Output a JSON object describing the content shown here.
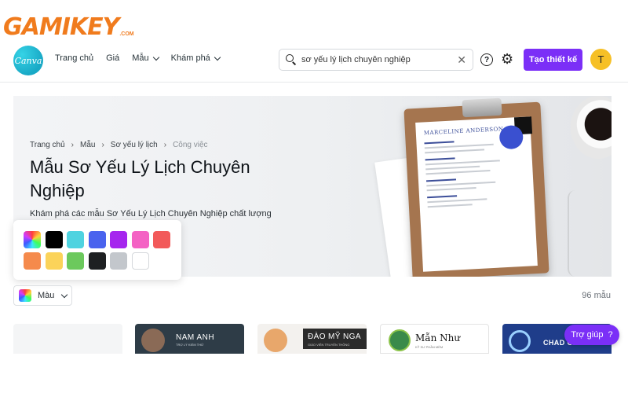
{
  "watermark": {
    "main": "GAMIKEY",
    "sub": ".COM"
  },
  "header": {
    "logo_text": "Canva",
    "nav": [
      {
        "label": "Trang chủ",
        "has_menu": false
      },
      {
        "label": "Giá",
        "has_menu": false
      },
      {
        "label": "Mẫu",
        "has_menu": true
      },
      {
        "label": "Khám phá",
        "has_menu": true
      }
    ],
    "search": {
      "value": "sơ yếu lý lịch chuyên nghiệp"
    },
    "help_glyph": "?",
    "create_button": "Tạo thiết kế",
    "avatar_initial": "T"
  },
  "hero": {
    "breadcrumb": [
      "Trang chủ",
      "Mẫu",
      "Sơ yếu lý lịch",
      "Công việc"
    ],
    "title": "Mẫu Sơ Yếu Lý Lịch Chuyên Nghiệp",
    "description": "Khám phá các mẫu Sơ Yếu Lý Lịch Chuyên Nghiệp chất lượng",
    "resume_name": "MARCELINE ANDERSON"
  },
  "color_filter": {
    "label": "Màu",
    "swatches": [
      "rainbow",
      "#000000",
      "#4fd3e0",
      "#4a63ee",
      "#a526ee",
      "#f462c4",
      "#f25a5a",
      "#f58a4c",
      "#fbd35a",
      "#6cc95d",
      "#1e2022",
      "#c3c7cc",
      "#ffffff"
    ]
  },
  "results_count": "96 mẫu",
  "cards": [
    {
      "name": "",
      "sub": ""
    },
    {
      "name": "NAM ANH",
      "sub": "TRỢ LÝ KIỂM THỬ"
    },
    {
      "name": "ĐÀO MỸ NGA",
      "sub": "GIÁO VIÊN TRUYỀN THÔNG"
    },
    {
      "name": "Mẫn Như",
      "sub": "KỸ SƯ PHẦN MỀM"
    },
    {
      "name": "CHAD GIBBONS",
      "sub": ""
    }
  ],
  "help_button": {
    "label": "Trợ giúp",
    "glyph": "?"
  }
}
